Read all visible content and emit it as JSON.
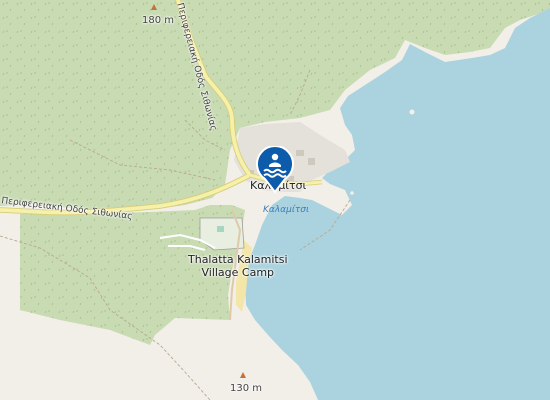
{
  "map": {
    "colors": {
      "land": "#f2efe9",
      "forest": "#c9dbb3",
      "sea": "#abd3df",
      "road": "#f6f1a8",
      "road_casing": "#d8cc7a",
      "pin": "#0d5cab"
    },
    "peaks": {
      "north": "180 m",
      "south": "130 m"
    },
    "roads": {
      "sithonia_ring_north": "Περιφερειακή Οδός Σιθωνίας",
      "sithonia_ring_west": "Περιφερειακή Οδός Σιθωνίας"
    },
    "places": {
      "village": "Καλαμίτσι",
      "bay": "Καλαμίτσι",
      "camp_line1": "Thalatta Kalamitsi",
      "camp_line2": "Village Camp"
    },
    "marker": {
      "icon": "swimming-icon",
      "label": "Καλαμίτσι"
    }
  }
}
